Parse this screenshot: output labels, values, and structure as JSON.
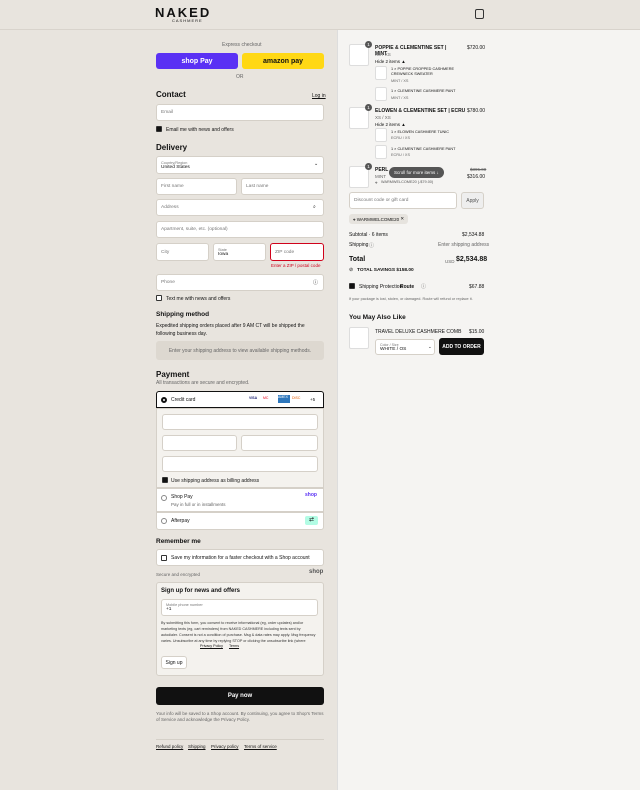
{
  "brand": {
    "name": "NAKED",
    "sub": "CASHMERE"
  },
  "express": {
    "label": "Express checkout",
    "shoppay": "shop Pay",
    "amazon": "amazon pay",
    "or": "OR"
  },
  "contact": {
    "title": "Contact",
    "login": "Log in",
    "email_ph": "Email",
    "newsletter": "Email me with news and offers"
  },
  "delivery": {
    "title": "Delivery",
    "country_label": "Country/Region",
    "country": "United States",
    "first": "First name",
    "last": "Last name",
    "address": "Address",
    "apt": "Apartment, suite, etc. (optional)",
    "city": "City",
    "state_label": "State",
    "state": "Iowa",
    "zip": "ZIP code",
    "zip_error": "Enter a ZIP / postal code",
    "phone": "Phone",
    "sms": "Text me with news and offers"
  },
  "shipping": {
    "title": "Shipping method",
    "note": "Expedited shipping orders placed after 9 AM CT will be shipped the following business day.",
    "box": "Enter your shipping address to view available shipping methods."
  },
  "payment": {
    "title": "Payment",
    "sub": "All transactions are secure and encrypted.",
    "credit": "Credit card",
    "cards": [
      "VISA",
      "MC",
      "AMEX",
      "DISC"
    ],
    "more": "+5",
    "billing": "Use shipping address as billing address",
    "shoppay": "Shop Pay",
    "shoppay_sub": "Pay in full or in installments",
    "shop_logo": "shop",
    "afterpay": "Afterpay"
  },
  "remember": {
    "title": "Remember me",
    "save": "Save my information for a faster checkout with a Shop account",
    "secure": "Secure and encrypted",
    "shop": "shop"
  },
  "signup": {
    "title": "Sign up for news and offers",
    "phone_label": "Mobile phone number",
    "phone_val": "+1",
    "legal": "By submitting this form, you consent to receive informational (eg, order updates) and/or marketing texts (eg, cart reminders) from NAKED CASHMERE including texts sent by autodialer. Consent is not a condition of purchase. Msg & data rates may apply. Msg frequency varies. Unsubscribe at any time by replying STOP or clicking the unsubscribe link (where available).",
    "privacy": "Privacy Policy",
    "terms": "Terms",
    "button": "Sign up"
  },
  "paynow": "Pay now",
  "footer_note": "Your info will be saved to a Shop account. By continuing, you agree to Shop's Terms of Service and acknowledge the Privacy Policy.",
  "footer_links": [
    "Refund policy",
    "Shipping",
    "Privacy policy",
    "Terms of service"
  ],
  "order": {
    "items": [
      {
        "qty": "1",
        "name": "POPPIE & CLEMENTINE SET | MINT",
        "size": "XS / XS",
        "price": "$720.00",
        "hide": "Hide 2 items ▲",
        "subs": [
          {
            "name": "1 × POPPIE CROPPED CASHMERE CREWNECK SWEATER",
            "meta": "MINT / XS"
          },
          {
            "name": "1 × CLEMENTINE CASHMERE PANT",
            "meta": "MINT / XS"
          }
        ]
      },
      {
        "qty": "1",
        "name": "ELOWEN & CLEMENTINE SET | ECRU",
        "size": "XS / XS",
        "price": "$780.00",
        "hide": "Hide 2 items ▲",
        "subs": [
          {
            "name": "1 × ELOWEN CASHMERE TUNIC",
            "meta": "ECRU / XS"
          },
          {
            "name": "1 × CLEMENTINE CASHMERE PANT",
            "meta": "ECRU / XS"
          }
        ]
      },
      {
        "qty": "1",
        "name": "PERL",
        "meta": "MINT",
        "code": "WARMWELCOME20 (-$79.00)",
        "old": "$395.00",
        "price": "$316.00"
      }
    ],
    "scroll_tip": "Scroll for more items ↓",
    "discount_ph": "Discount code or gift card",
    "apply": "Apply",
    "tag": "WARMWELCOME20",
    "subtotal_label": "Subtotal · 6 items",
    "subtotal": "$2,534.88",
    "shipping_label": "Shipping",
    "shipping_val": "Enter shipping address",
    "total_label": "Total",
    "currency": "USD",
    "total": "$2,534.88",
    "savings": "TOTAL SAVINGS $158.00",
    "protection": "Shipping Protection",
    "route": "Route",
    "protection_price": "$67.88",
    "protection_note": "If your package is lost, stolen, or damaged. Route will refund or replace it.",
    "also_title": "You May Also Like",
    "also_name": "TRAVEL DELUXE CASHMERE COMB",
    "also_price": "$15.00",
    "also_sel_label": "Color / Size",
    "also_sel": "WHITE / OS",
    "also_btn": "ADD TO ORDER"
  },
  "colors": {
    "shoppay": "#5a31f4",
    "amazon": "#ffd814",
    "error": "#d0021b",
    "afterpay": "#b2fce4"
  }
}
